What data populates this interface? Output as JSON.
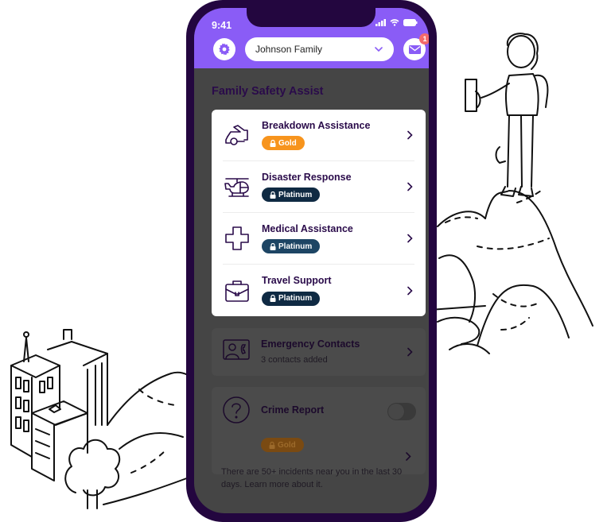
{
  "status_bar": {
    "time": "9:41"
  },
  "header": {
    "family_selector": {
      "value": "Johnson Family"
    },
    "inbox_unread_count": "1"
  },
  "section_title": "Family Safety Assist",
  "services": [
    {
      "title": "Breakdown Assistance",
      "tier": "Gold",
      "icon": "car-breakdown-icon"
    },
    {
      "title": "Disaster Response",
      "tier": "Platinum",
      "icon": "helicopter-icon"
    },
    {
      "title": "Medical Assistance",
      "tier": "Platinum",
      "icon": "medical-cross-icon"
    },
    {
      "title": "Travel Support",
      "tier": "Platinum",
      "icon": "briefcase-icon"
    }
  ],
  "emergency_contacts": {
    "title": "Emergency Contacts",
    "subtitle": "3 contacts added"
  },
  "crime_report": {
    "title": "Crime Report",
    "tier": "Gold",
    "toggle_on": false,
    "note": "There are 50+ incidents near you in the last 30 days. Learn more about it."
  },
  "colors": {
    "header_purple": "#8a5cf6",
    "phone_frame": "#23063f",
    "title_purple": "#2a0b4a",
    "gold": "#f7941d",
    "platinum": "#0f2a43",
    "notification": "#f36a6a"
  }
}
